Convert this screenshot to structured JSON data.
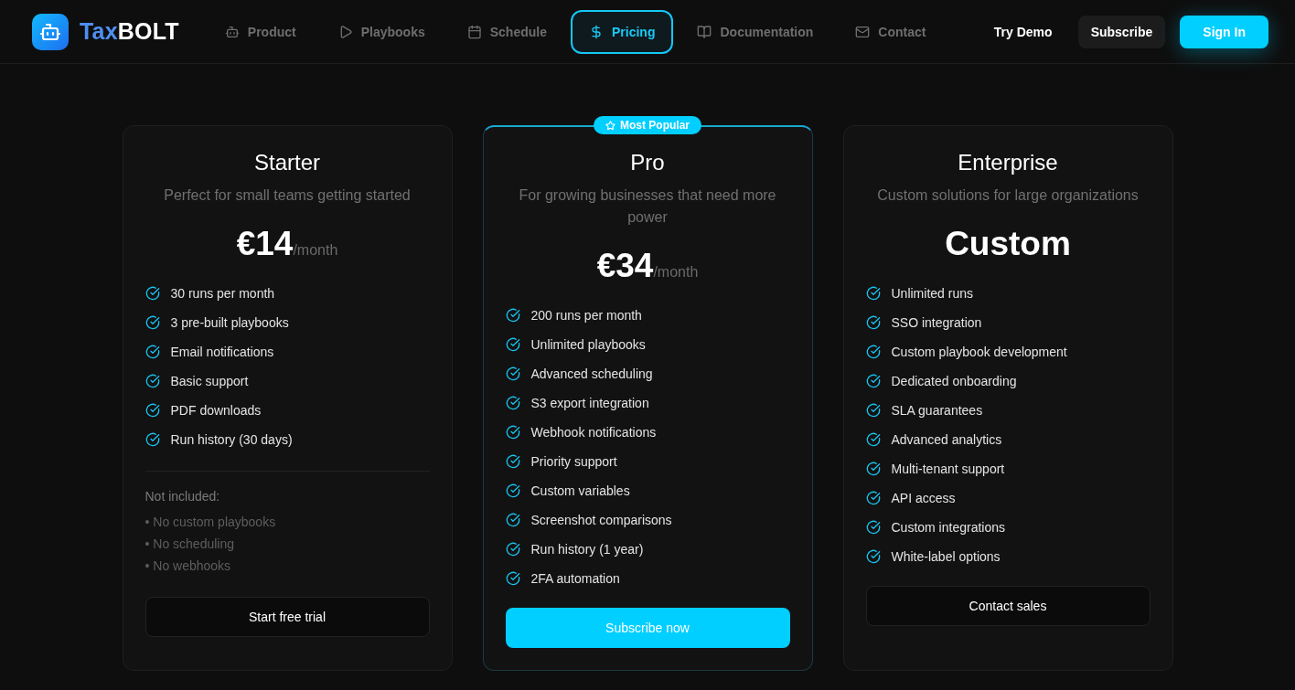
{
  "brand": {
    "prefix": "Tax",
    "suffix": "BOLT"
  },
  "nav": {
    "items": [
      {
        "label": "Product",
        "selected": false
      },
      {
        "label": "Playbooks",
        "selected": false
      },
      {
        "label": "Schedule",
        "selected": false
      },
      {
        "label": "Pricing",
        "selected": true
      },
      {
        "label": "Documentation",
        "selected": false
      },
      {
        "label": "Contact",
        "selected": false
      }
    ]
  },
  "actions": [
    {
      "label": "Try Demo",
      "kind": "text"
    },
    {
      "label": "Subscribe",
      "kind": "secondary"
    },
    {
      "label": "Sign In",
      "kind": "primary"
    }
  ],
  "plans": [
    {
      "name": "Starter",
      "featured": false,
      "description": "Perfect for small teams getting started",
      "price": {
        "amount": "€14",
        "period": "/month"
      },
      "features": [
        "30 runs per month",
        "3 pre-built playbooks",
        "Email notifications",
        "Basic support",
        "PDF downloads",
        "Run history (30 days)"
      ],
      "not_included": {
        "title": "Not included:",
        "items": [
          "• No custom playbooks",
          "• No scheduling",
          "• No webhooks"
        ]
      },
      "button": {
        "label": "Start free trial",
        "kind": "outline"
      }
    },
    {
      "name": "Pro",
      "featured": true,
      "badge": "Most Popular",
      "description": "For growing businesses that need more power",
      "price": {
        "amount": "€34",
        "period": "/month"
      },
      "features": [
        "200 runs per month",
        "Unlimited playbooks",
        "Advanced scheduling",
        "S3 export integration",
        "Webhook notifications",
        "Priority support",
        "Custom variables",
        "Screenshot comparisons",
        "Run history (1 year)",
        "2FA automation"
      ],
      "button": {
        "label": "Subscribe now",
        "kind": "primary"
      }
    },
    {
      "name": "Enterprise",
      "featured": false,
      "description": "Custom solutions for large organizations",
      "price": {
        "amount": "Custom"
      },
      "features": [
        "Unlimited runs",
        "SSO integration",
        "Custom playbook development",
        "Dedicated onboarding",
        "SLA guarantees",
        "Advanced analytics",
        "Multi-tenant support",
        "API access",
        "Custom integrations",
        "White-label options"
      ],
      "button": {
        "label": "Contact sales",
        "kind": "outline"
      }
    }
  ]
}
